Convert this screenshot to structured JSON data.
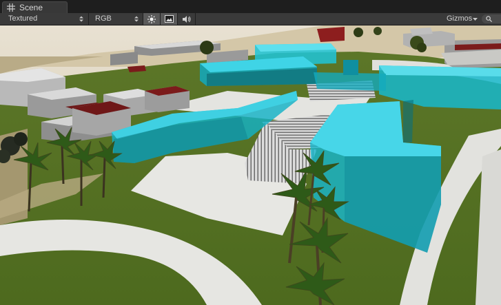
{
  "window": {
    "tab_label": "Scene",
    "tab_icon": "grid-icon"
  },
  "toolbar": {
    "render_mode": "Textured",
    "color_mode": "RGB",
    "lighting_icon": "sun-icon",
    "image_icon": "image-icon",
    "audio_icon": "speaker-icon",
    "gizmos_label": "Gizmos",
    "search_icon": "search-icon"
  },
  "scene": {
    "description_colors": {
      "sky": "#d9cfb9",
      "grass": "#5f7a2a",
      "glass": "#19c3d6",
      "roof": "#7b1b1b",
      "path": "#e8e8e4"
    }
  }
}
